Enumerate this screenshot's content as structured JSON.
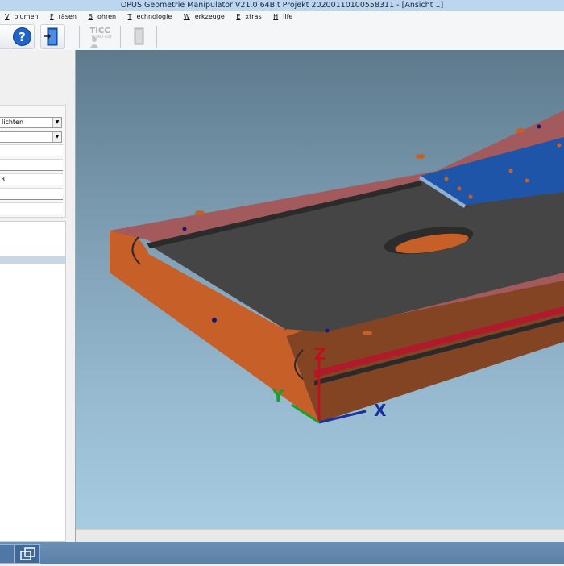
{
  "window": {
    "title": "OPUS Geometrie Manipulator V21.0 64Bit   Projekt 20200110100558311 - [Ansicht 1]"
  },
  "menu": [
    {
      "ul": "V",
      "rest": "olumen"
    },
    {
      "ul": "F",
      "rest": "räsen"
    },
    {
      "ul": "B",
      "rest": "ohren"
    },
    {
      "ul": "T",
      "rest": "echnologie"
    },
    {
      "ul": "W",
      "rest": "erkzeuge"
    },
    {
      "ul": "E",
      "rest": "xtras"
    },
    {
      "ul": "H",
      "rest": "ilfe"
    }
  ],
  "toolbar": {
    "help_glyph": "?",
    "ticc_logo": "TICC",
    "ticc_sub": "WORK FLOW"
  },
  "left_panel": {
    "combo1": "lichten",
    "combo2": "",
    "field3": "3"
  },
  "axes": {
    "x": "X",
    "y": "Y",
    "z": "Z"
  },
  "colors": {
    "top_face": "#a35a5c",
    "side_face": "#c65f28",
    "pocket": "#454545",
    "plate": "#1f55a8",
    "red_stripe": "#b11a2a"
  }
}
